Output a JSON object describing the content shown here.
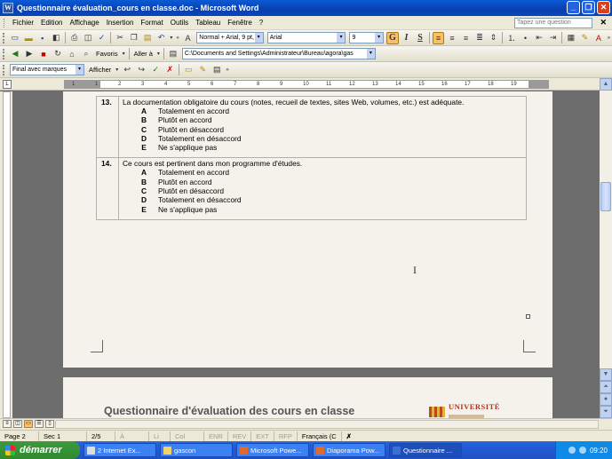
{
  "window": {
    "title": "Questionnaire évaluation_cours en classe.doc - Microsoft Word",
    "app_icon": "W"
  },
  "menu": {
    "items": [
      "Fichier",
      "Edition",
      "Affichage",
      "Insertion",
      "Format",
      "Outils",
      "Tableau",
      "Fenêtre",
      "?"
    ],
    "help_placeholder": "Tapez une question"
  },
  "formatting": {
    "style": "Normal + Arial, 9 pt,",
    "font": "Arial",
    "size": "9"
  },
  "web": {
    "favorites_label": "Favoris",
    "goto_label": "Aller à",
    "address": "C:\\Documents and Settings\\Administrateur\\Bureau\\agora\\gas"
  },
  "review": {
    "display_mode": "Final avec marques",
    "show_label": "Afficher"
  },
  "ruler": {
    "labels": [
      "1",
      "1",
      "2",
      "3",
      "4",
      "5",
      "6",
      "7",
      "8",
      "9",
      "10",
      "11",
      "12",
      "13",
      "14",
      "15",
      "16",
      "17",
      "18",
      "19"
    ]
  },
  "document": {
    "questions": [
      {
        "number": "13.",
        "text": "La documentation obligatoire du cours (notes, recueil de textes, sites Web, volumes, etc.) est adéquate.",
        "options": [
          {
            "letter": "A",
            "text": "Totalement en accord"
          },
          {
            "letter": "B",
            "text": "Plutôt en accord"
          },
          {
            "letter": "C",
            "text": "Plutôt en désaccord"
          },
          {
            "letter": "D",
            "text": "Totalement en désaccord"
          },
          {
            "letter": "E",
            "text": "Ne s'applique pas"
          }
        ]
      },
      {
        "number": "14.",
        "text": "Ce cours est pertinent dans mon programme d'études.",
        "options": [
          {
            "letter": "A",
            "text": "Totalement en accord"
          },
          {
            "letter": "B",
            "text": "Plutôt en accord"
          },
          {
            "letter": "C",
            "text": "Plutôt en désaccord"
          },
          {
            "letter": "D",
            "text": "Totalement en désaccord"
          },
          {
            "letter": "E",
            "text": "Ne s'applique pas"
          }
        ]
      }
    ],
    "next_page_title": "Questionnaire d'évaluation des cours en classe",
    "logo_text": "UNIVERSITÉ"
  },
  "status": {
    "page": "Page 2",
    "section": "Sec 1",
    "pages": "2/5",
    "at": "À",
    "line": "Li",
    "col": "Col",
    "rec": "ENR",
    "rev": "REV",
    "ext": "EXT",
    "ovr": "RFP",
    "language": "Français (C"
  },
  "taskbar": {
    "start_label": "démarrer",
    "tasks": [
      {
        "label": "2 Internet Ex..."
      },
      {
        "label": "gascon"
      },
      {
        "label": "Microsoft Powe..."
      },
      {
        "label": "Diaporama Pow..."
      },
      {
        "label": "Questionnaire ..."
      }
    ],
    "clock": "09:20"
  }
}
